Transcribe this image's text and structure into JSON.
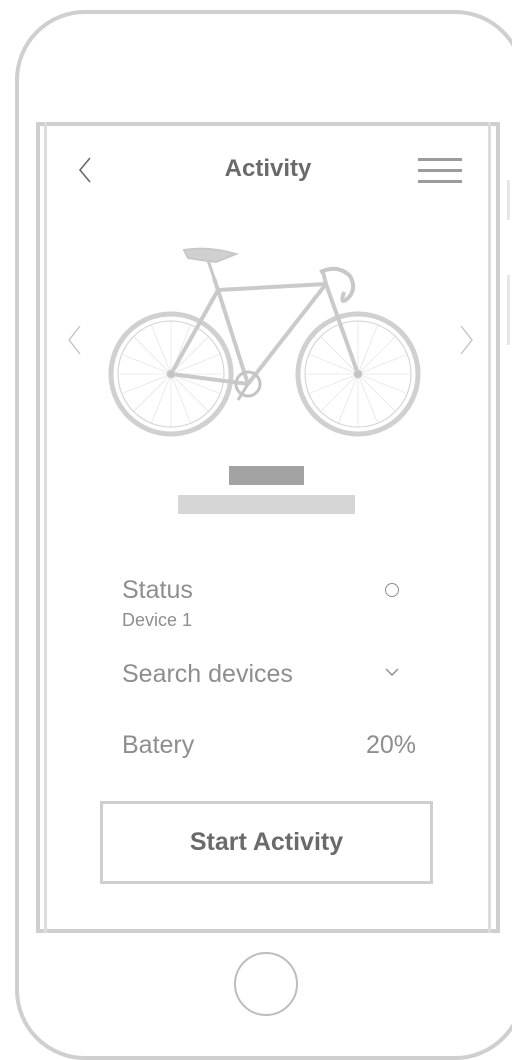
{
  "header": {
    "title": "Activity"
  },
  "device": {
    "status_label": "Status",
    "device_name": "Device 1",
    "search_label": "Search devices",
    "battery_label": "Batery",
    "battery_value": "20%"
  },
  "actions": {
    "start_label": "Start Activity"
  },
  "icons": {
    "back": "chevron-left-icon",
    "menu": "hamburger-menu-icon",
    "prev": "chevron-left-icon",
    "next": "chevron-right-icon",
    "status": "circle-icon",
    "dropdown": "chevron-down-icon",
    "bike": "bicycle-image",
    "home": "home-button"
  },
  "colors": {
    "frame": "#cfcfcf",
    "text": "#8e8e8e",
    "title_text": "#6a6a6a",
    "placeholder_dark": "#a3a3a3",
    "placeholder_light": "#d6d6d6"
  }
}
